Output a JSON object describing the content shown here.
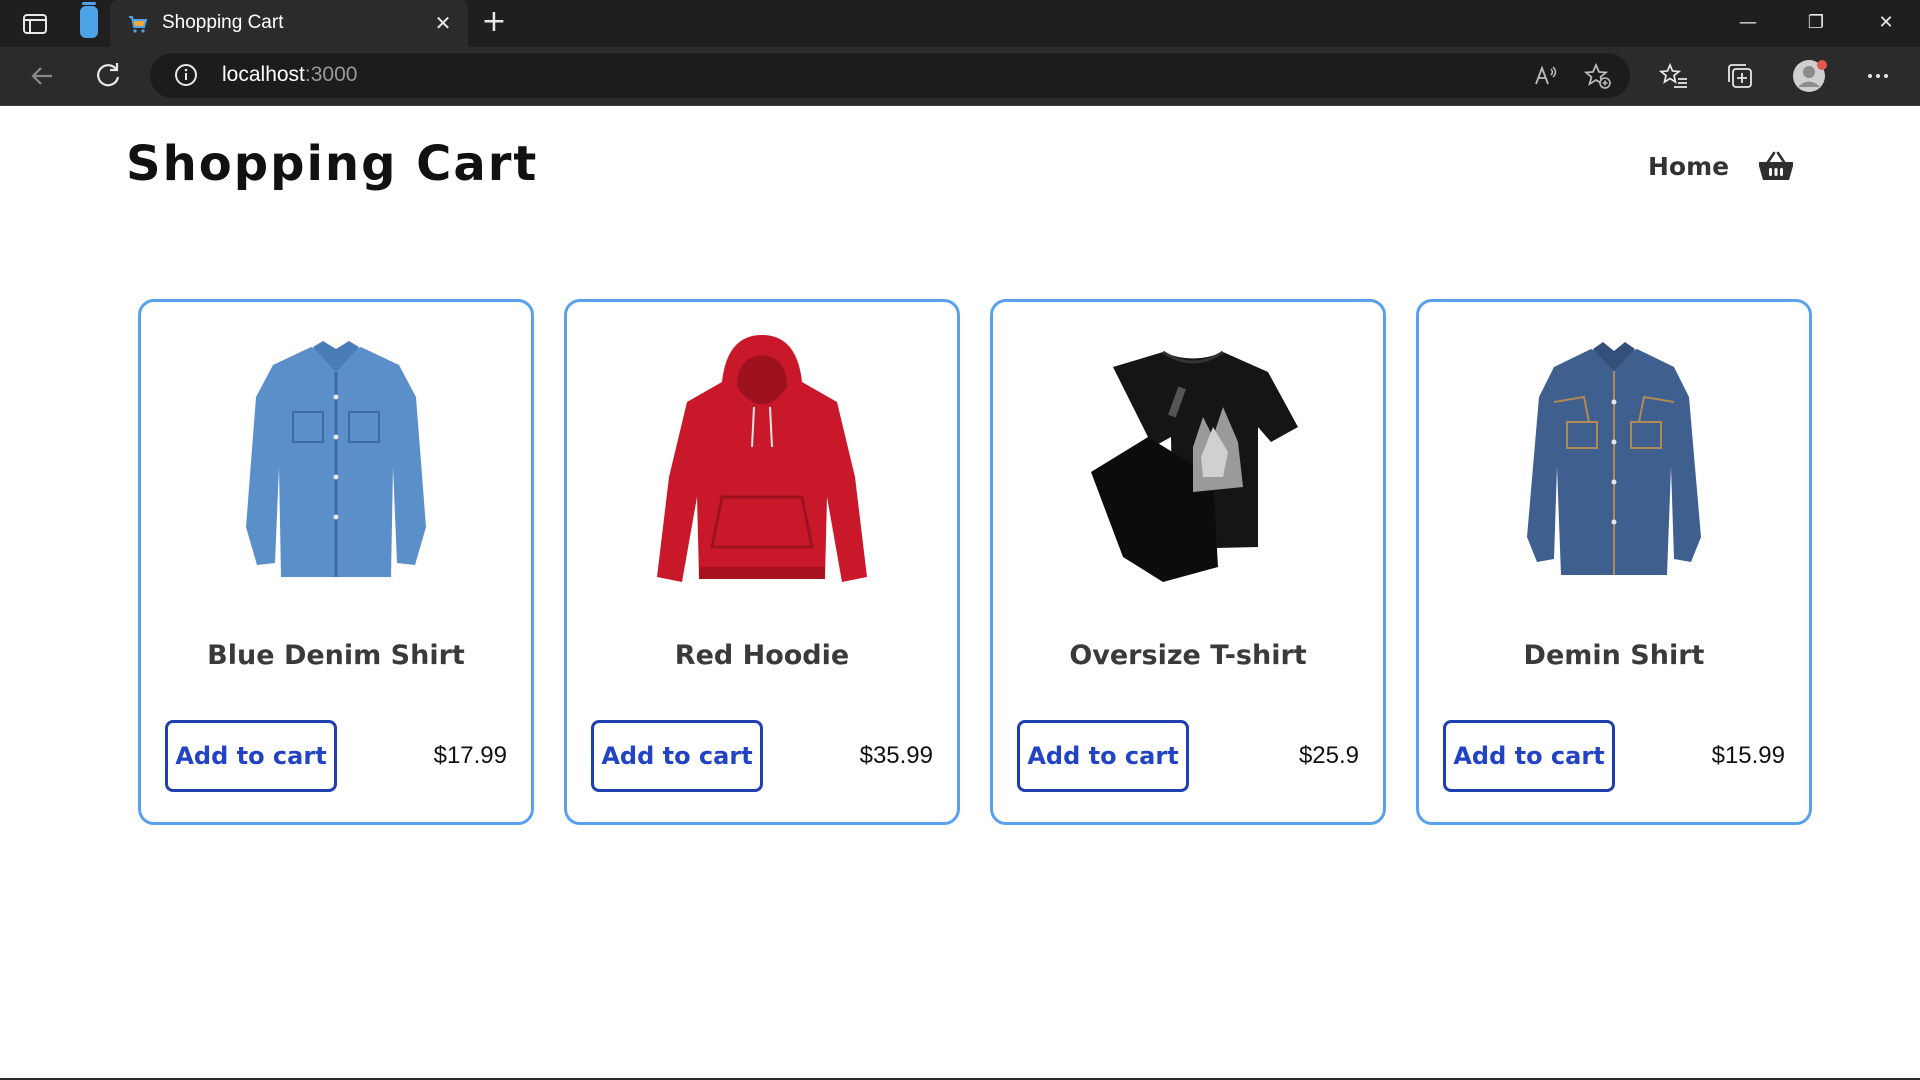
{
  "browser": {
    "tab_title": "Shopping Cart",
    "tab_close_icon": "close-icon",
    "new_tab_icon": "plus-icon",
    "url_host": "localhost",
    "url_port": ":3000",
    "window_controls": [
      "minimize-icon",
      "restore-icon",
      "close-icon"
    ],
    "toolbar_icons": [
      "back-icon",
      "refresh-icon",
      "info-icon",
      "read-aloud-icon",
      "add-favorite-icon",
      "favorites-icon",
      "collections-icon",
      "profile-avatar",
      "more-icon"
    ]
  },
  "header": {
    "title": "Shopping Cart",
    "nav_home": "Home",
    "cart_icon": "basket-icon"
  },
  "colors": {
    "card_border": "#5aa1ec",
    "button_border": "#1f3fae",
    "button_text": "#2244c4"
  },
  "products": [
    {
      "name": "Blue Denim Shirt",
      "price": "$17.99",
      "button": "Add to cart",
      "image": "denim-shirt-image"
    },
    {
      "name": "Red Hoodie",
      "price": "$35.99",
      "button": "Add to cart",
      "image": "red-hoodie-image"
    },
    {
      "name": "Oversize T-shirt",
      "price": "$25.9",
      "button": "Add to cart",
      "image": "black-tshirt-image"
    },
    {
      "name": "Demin Shirt",
      "price": "$15.99",
      "button": "Add to cart",
      "image": "dark-denim-shirt-image"
    }
  ]
}
